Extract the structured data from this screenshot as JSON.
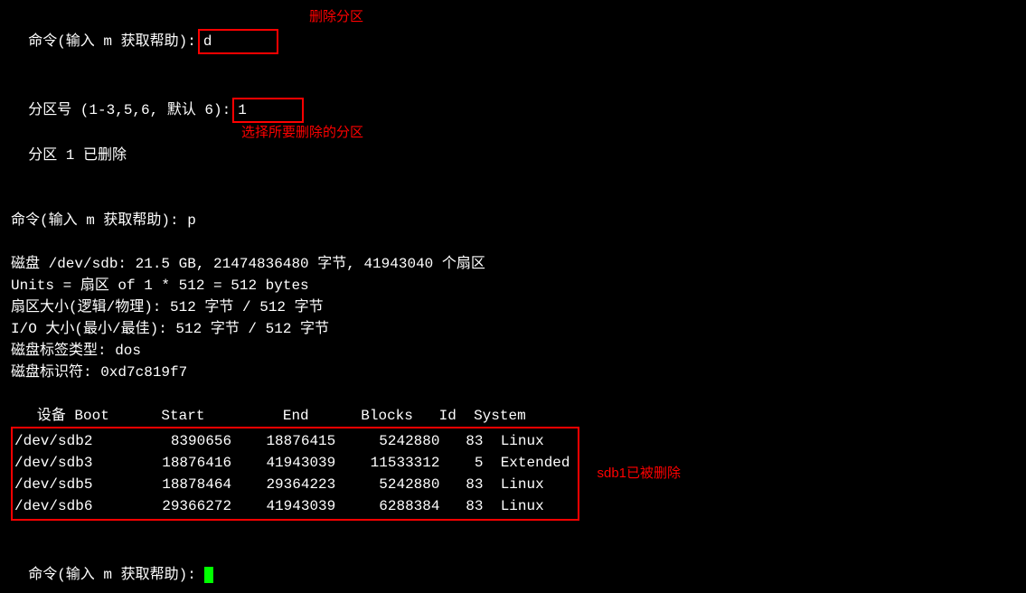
{
  "line1_prompt": "命令(输入 m 获取帮助):",
  "line1_input": "d",
  "annot1": "删除分区",
  "line2_prompt": "分区号 (1-3,5,6, 默认 6):",
  "line2_input": "1",
  "annot2": "选择所要删除的分区",
  "line3": "分区 1 已删除",
  "line4": "命令(输入 m 获取帮助): p",
  "disk_info": [
    "磁盘 /dev/sdb: 21.5 GB, 21474836480 字节, 41943040 个扇区",
    "Units = 扇区 of 1 * 512 = 512 bytes",
    "扇区大小(逻辑/物理): 512 字节 / 512 字节",
    "I/O 大小(最小/最佳): 512 字节 / 512 字节",
    "磁盘标签类型: dos",
    "磁盘标识符: 0xd7c819f7"
  ],
  "table_header": "   设备 Boot      Start         End      Blocks   Id  System",
  "table_rows": [
    "/dev/sdb2         8390656    18876415     5242880   83  Linux",
    "/dev/sdb3        18876416    41943039    11533312    5  Extended",
    "/dev/sdb5        18878464    29364223     5242880   83  Linux",
    "/dev/sdb6        29366272    41943039     6288384   83  Linux"
  ],
  "annot3": "sdb1已被删除",
  "line_final_prompt": "命令(输入 m 获取帮助): ",
  "chart_data": {
    "type": "table",
    "title": "fdisk partition table for /dev/sdb",
    "columns": [
      "设备",
      "Boot",
      "Start",
      "End",
      "Blocks",
      "Id",
      "System"
    ],
    "rows": [
      {
        "设备": "/dev/sdb2",
        "Boot": "",
        "Start": 8390656,
        "End": 18876415,
        "Blocks": 5242880,
        "Id": "83",
        "System": "Linux"
      },
      {
        "设备": "/dev/sdb3",
        "Boot": "",
        "Start": 18876416,
        "End": 41943039,
        "Blocks": 11533312,
        "Id": "5",
        "System": "Extended"
      },
      {
        "设备": "/dev/sdb5",
        "Boot": "",
        "Start": 18878464,
        "End": 29364223,
        "Blocks": 5242880,
        "Id": "83",
        "System": "Linux"
      },
      {
        "设备": "/dev/sdb6",
        "Boot": "",
        "Start": 29366272,
        "End": 41943039,
        "Blocks": 6288384,
        "Id": "83",
        "System": "Linux"
      }
    ]
  }
}
